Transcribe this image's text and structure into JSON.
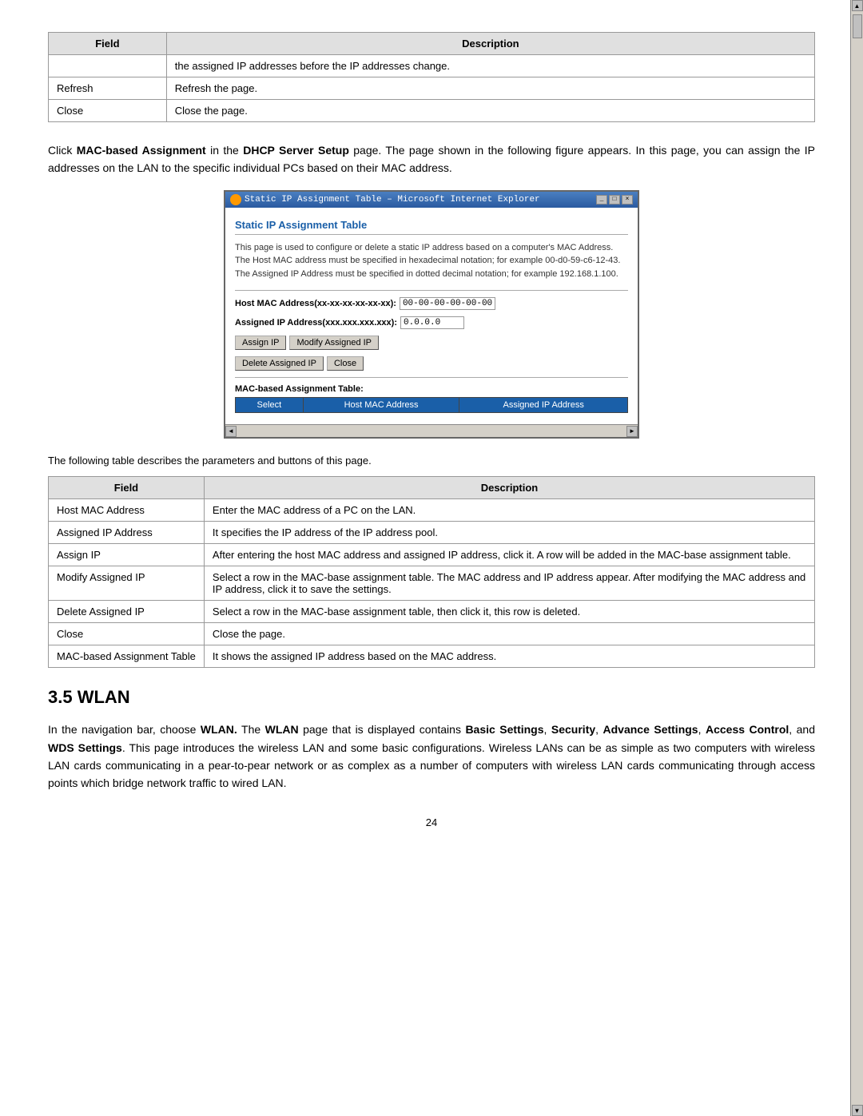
{
  "top_table": {
    "headers": [
      "Field",
      "Description"
    ],
    "rows": [
      [
        "",
        "the assigned IP addresses before the IP addresses change."
      ],
      [
        "Refresh",
        "Refresh the page."
      ],
      [
        "Close",
        "Close the page."
      ]
    ]
  },
  "intro_paragraph": "Click MAC-based Assignment in the DHCP Server Setup page. The page shown in the following figure appears. In this page, you can assign the IP addresses on the LAN to the specific individual PCs based on their MAC address.",
  "ie_window": {
    "titlebar": "Static IP Assignment Table – Microsoft Internet Explorer",
    "page_title": "Static IP Assignment Table",
    "description": "This page is used to configure or delete a static IP address based on a computer's MAC Address. The Host MAC address must be specified in hexadecimal notation; for example 00-d0-59-c6-12-43. The Assigned IP Address must be specified in dotted decimal notation; for example 192.168.1.100.",
    "host_mac_label": "Host MAC Address(xx-xx-xx-xx-xx-xx):",
    "host_mac_value": "00-00-00-00-00-00",
    "assigned_ip_label": "Assigned IP Address(xxx.xxx.xxx.xxx):",
    "assigned_ip_value": "0.0.0.0",
    "buttons": [
      "Assign IP",
      "Modify Assigned IP",
      "Delete Assigned IP",
      "Close"
    ],
    "mac_table_label": "MAC-based Assignment Table:",
    "mac_table_headers": [
      "Select",
      "Host MAC Address",
      "Assigned IP Address"
    ]
  },
  "caption": "The following table describes the parameters and buttons of this page.",
  "desc_table": {
    "headers": [
      "Field",
      "Description"
    ],
    "rows": [
      [
        "Host MAC Address",
        "Enter the MAC address of a PC on the LAN."
      ],
      [
        "Assigned IP Address",
        "It specifies the IP address of the IP address pool."
      ],
      [
        "Assign IP",
        "After entering the host MAC address and assigned IP address, click it. A row will be added in the MAC-base assignment table."
      ],
      [
        "Modify Assigned IP",
        "Select a row in the MAC-base assignment table. The MAC address and IP address appear. After modifying the MAC address and IP address, click it to save the settings."
      ],
      [
        "Delete Assigned IP",
        "Select a row in the MAC-base assignment table, then click it, this row is deleted."
      ],
      [
        "Close",
        "Close the page."
      ],
      [
        "MAC-based Assignment Table",
        "It shows the assigned IP address based on the MAC address."
      ]
    ]
  },
  "section": {
    "number": "3.5",
    "title": "WLAN"
  },
  "wlan_paragraph": "In the navigation bar, choose WLAN. The WLAN page that is displayed contains Basic Settings, Security, Advance Settings, Access Control, and WDS Settings. This page introduces the wireless LAN and some basic configurations. Wireless LANs can be as simple as two computers with wireless LAN cards communicating in a pear-to-pear network or as complex as a number of computers with wireless LAN cards communicating through access points which bridge network traffic to wired LAN.",
  "page_number": "24"
}
